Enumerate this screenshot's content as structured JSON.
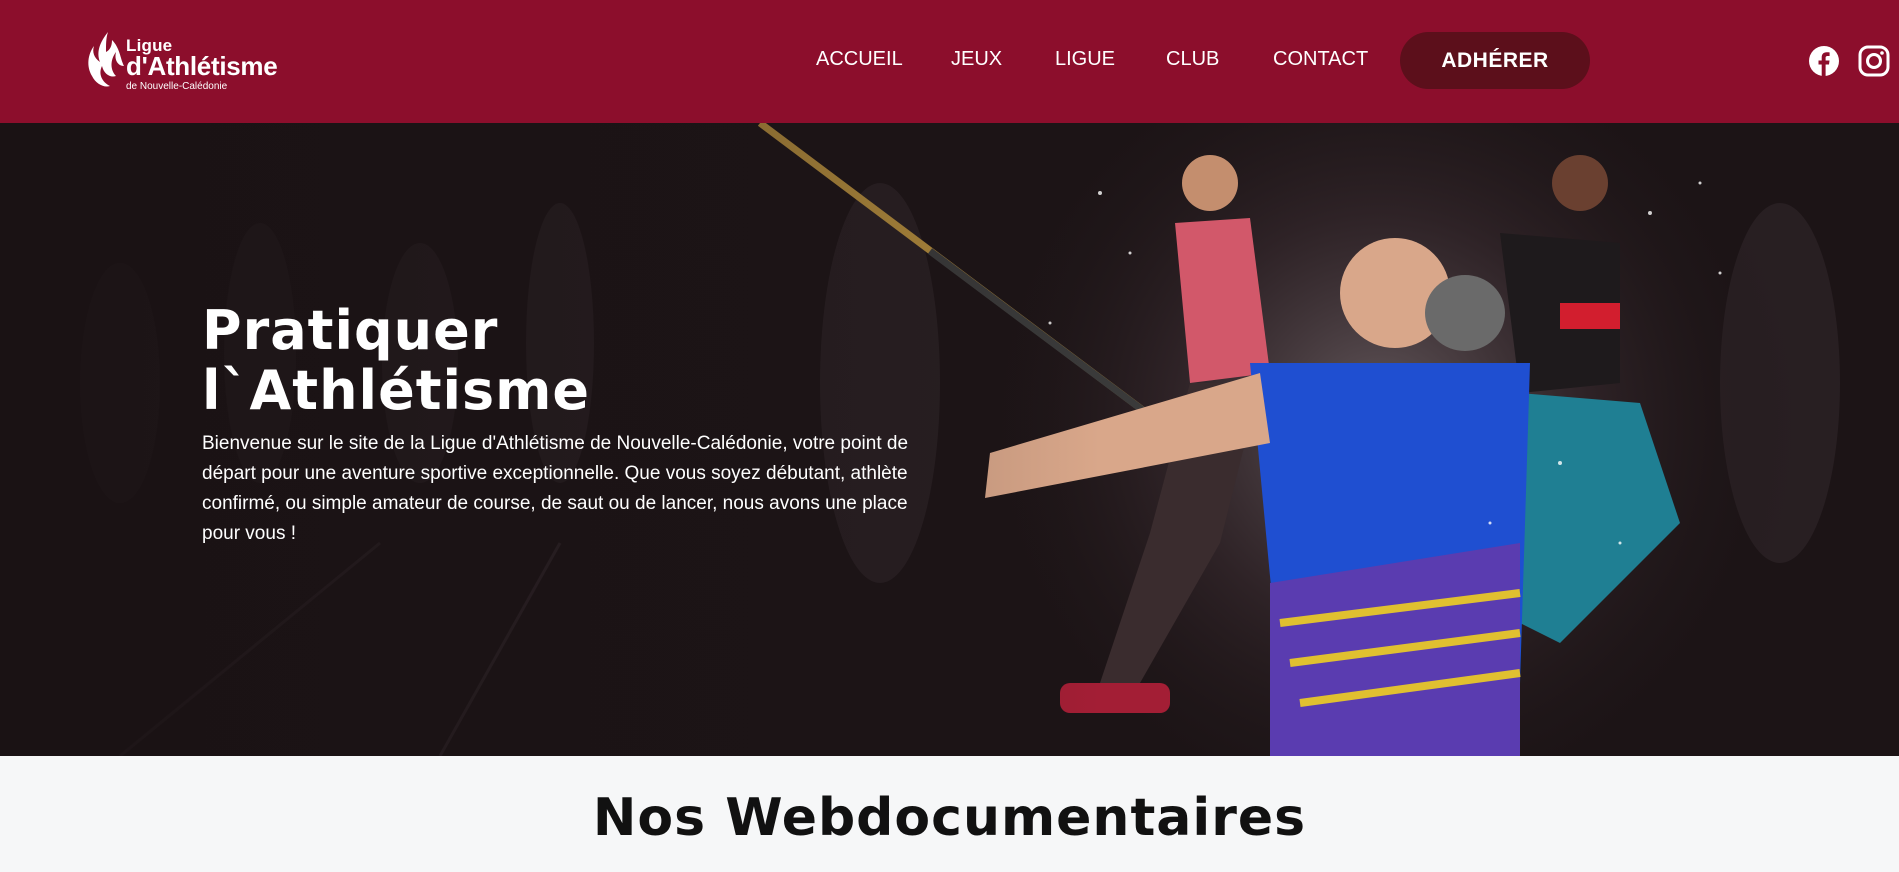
{
  "header": {
    "logo": {
      "line1": "Ligue",
      "line2": "d'Athlétisme",
      "line3": "de Nouvelle-Calédonie"
    },
    "nav": [
      {
        "label": "ACCUEIL"
      },
      {
        "label": "JEUX"
      },
      {
        "label": "LIGUE"
      },
      {
        "label": "CLUB"
      },
      {
        "label": "CONTACT"
      }
    ],
    "cta_label": "ADHÉRER",
    "social": [
      "facebook-icon",
      "instagram-icon"
    ]
  },
  "hero": {
    "title_line1": "Pratiquer",
    "title_line2": "l`Athlétisme",
    "text": "Bienvenue sur le site de la Ligue d'Athlétisme de Nouvelle-Calédonie, votre point de départ pour une aventure sportive exceptionnelle. Que vous soyez débutant, athlète confirmé, ou simple amateur de course, de saut ou de lancer, nous avons une place pour vous !"
  },
  "section": {
    "title": "Nos Webdocumentaires"
  },
  "colors": {
    "header_bg": "#8c0e2c",
    "cta_bg": "#5c0f1b",
    "hero_bg": "#1a1214",
    "section_bg": "#f6f7f8"
  }
}
